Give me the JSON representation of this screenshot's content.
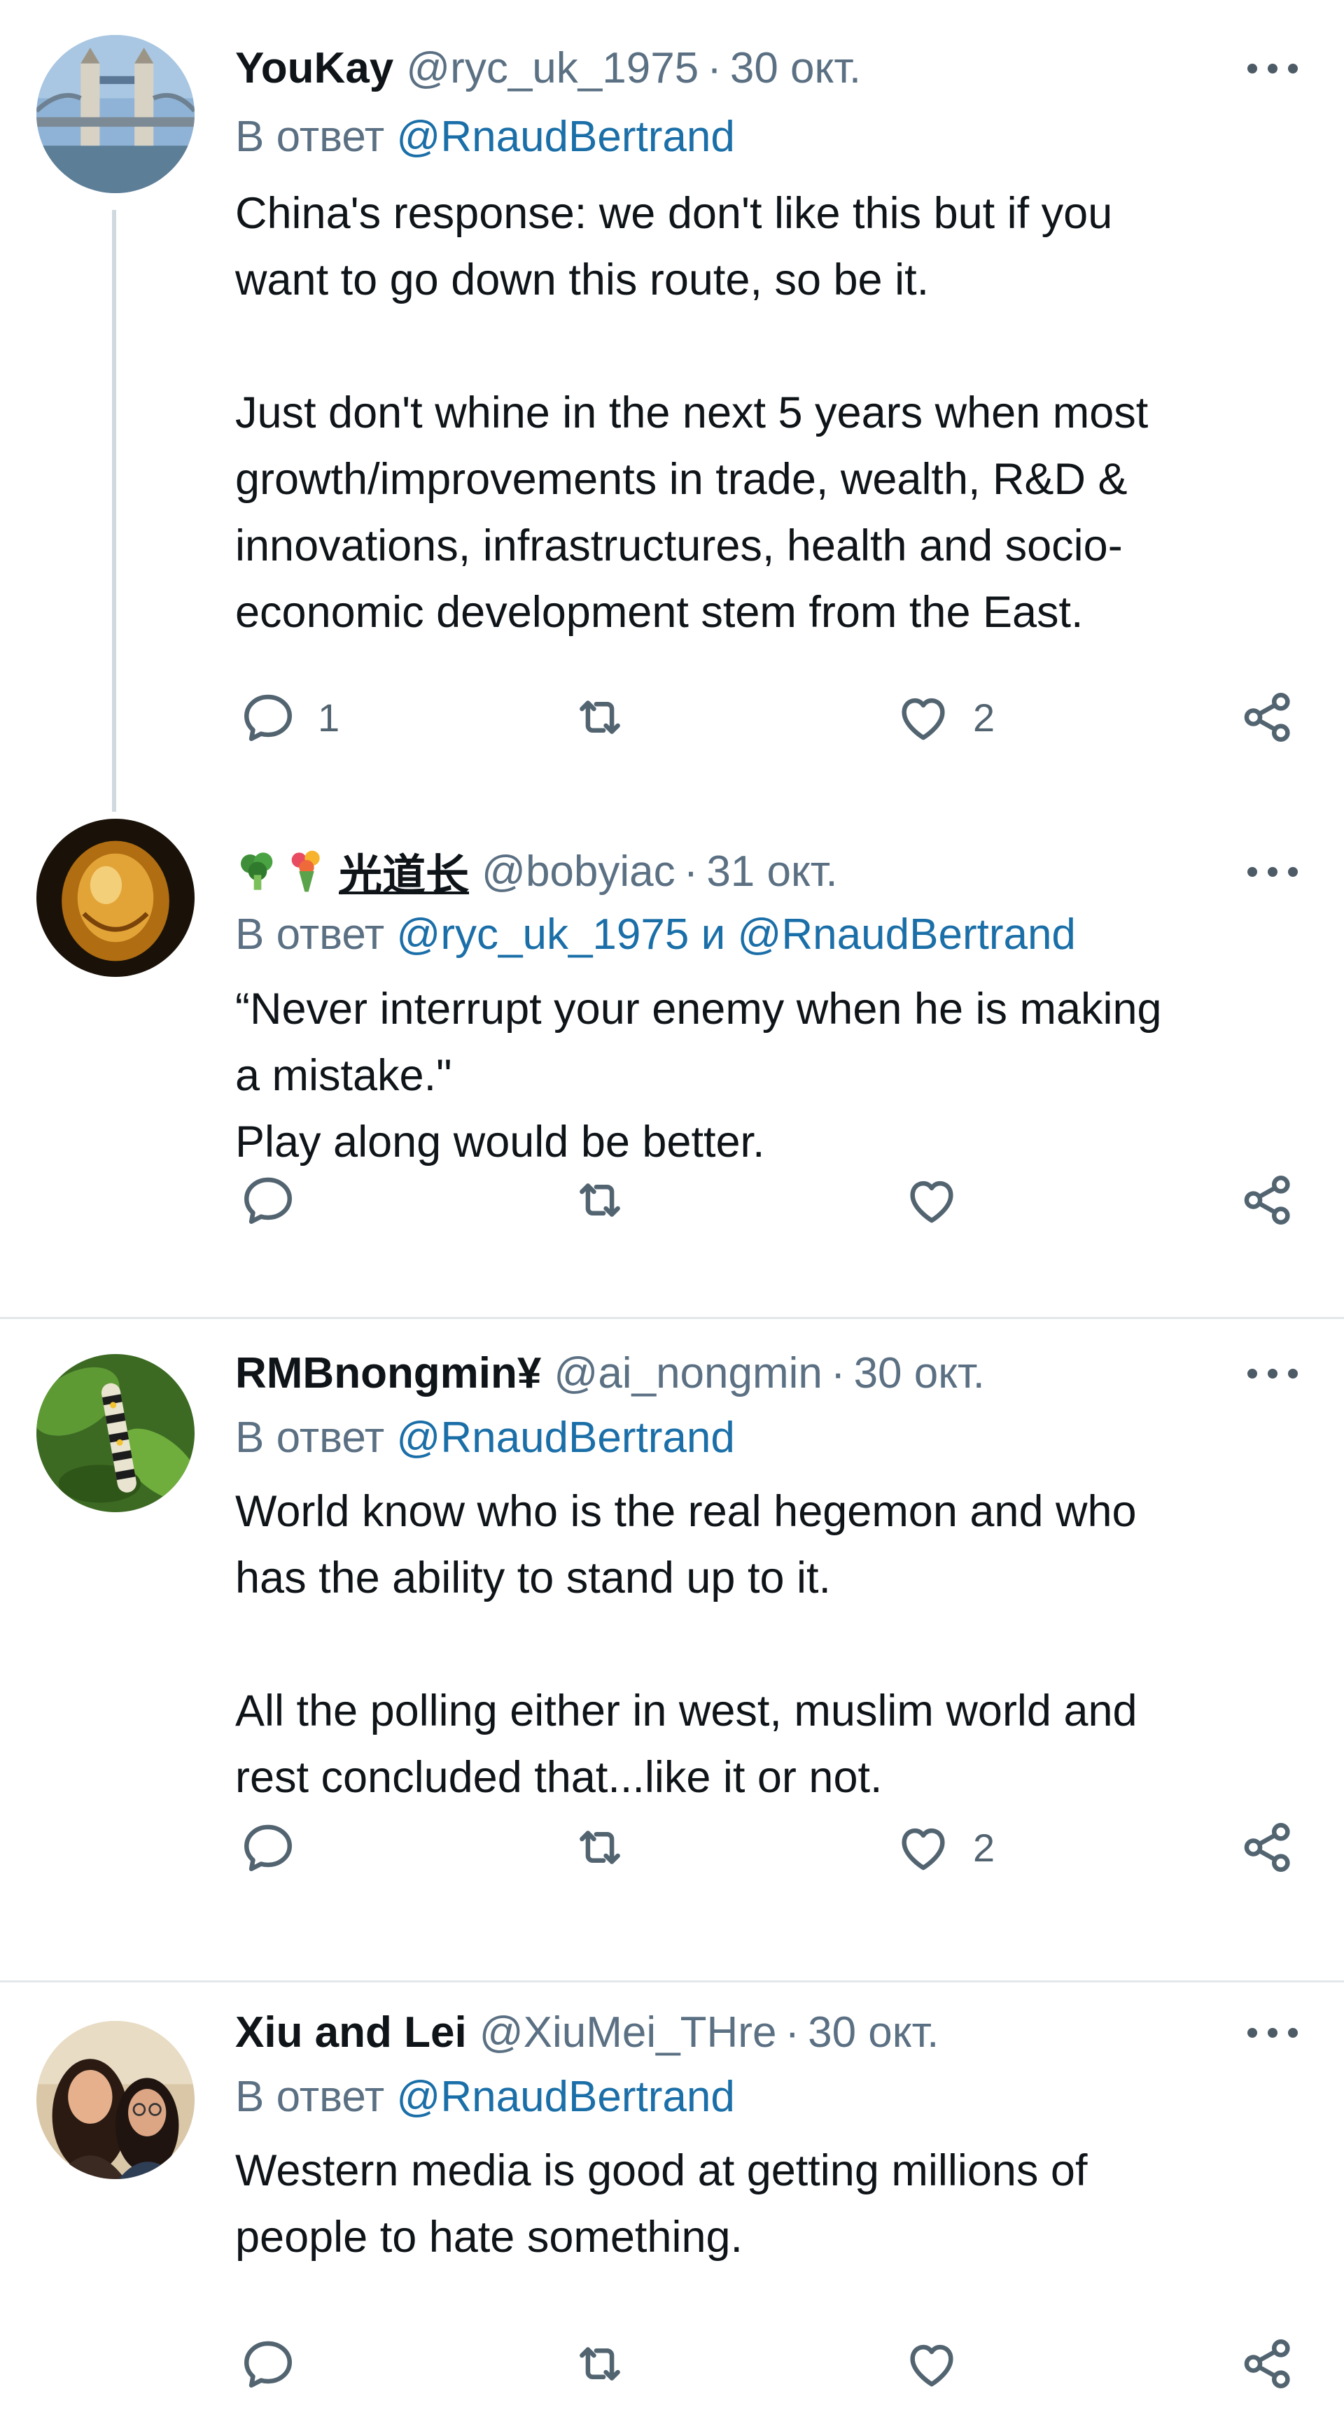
{
  "tweets": [
    {
      "name": "YouKay",
      "name_emojis": [],
      "handle": "@ryc_uk_1975",
      "separator": "·",
      "date": "30 окт.",
      "reply_prefix": "В ответ",
      "reply_mentions": [
        "@RnaudBertrand"
      ],
      "reply_joiner": "",
      "lines": [
        "China's response: we don't like this but if you",
        "want to go down this route, so be it.",
        "",
        "Just don't whine in the next 5 years when most",
        "growth/improvements in trade, wealth, R&D &",
        "innovations, infrastructures, health and socio-",
        "economic development stem from the East."
      ],
      "replies": "1",
      "retweets": "",
      "likes": "2",
      "avatar_icon": "tower-bridge-avatar"
    },
    {
      "name": "光道长",
      "name_emojis": [
        "broccoli-icon",
        "bouquet-icon"
      ],
      "handle": "@bobyiac",
      "separator": "·",
      "date": "31 окт.",
      "reply_prefix": "В ответ",
      "reply_mentions": [
        "@ryc_uk_1975",
        "@RnaudBertrand"
      ],
      "reply_joiner": "и",
      "lines": [
        "“Never interrupt your enemy when he is making",
        "a mistake.\"",
        "Play along would be better."
      ],
      "replies": "",
      "retweets": "",
      "likes": "",
      "avatar_icon": "amber-shell-avatar"
    },
    {
      "name": "RMBnongmin¥",
      "name_emojis": [],
      "handle": "@ai_nongmin",
      "separator": "·",
      "date": "30 окт.",
      "reply_prefix": "В ответ",
      "reply_mentions": [
        "@RnaudBertrand"
      ],
      "reply_joiner": "",
      "lines": [
        "World know who is the real hegemon and who",
        "has the ability to stand up to it.",
        "",
        "All the polling either in west, muslim world and",
        "rest concluded that...like it or not."
      ],
      "replies": "",
      "retweets": "",
      "likes": "2",
      "avatar_icon": "caterpillar-avatar"
    },
    {
      "name": "Xiu and Lei",
      "name_emojis": [],
      "handle": "@XiuMei_THre",
      "separator": "·",
      "date": "30 окт.",
      "reply_prefix": "В ответ",
      "reply_mentions": [
        "@RnaudBertrand"
      ],
      "reply_joiner": "",
      "lines": [
        "Western media is good at getting millions of",
        "people to hate something."
      ],
      "replies": "",
      "retweets": "",
      "likes": "",
      "avatar_icon": "two-women-avatar"
    }
  ],
  "icons": {
    "reply": "reply-icon",
    "retweet": "retweet-icon",
    "like": "heart-icon",
    "share": "share-icon",
    "more": "more-icon"
  },
  "colors": {
    "text": "#0f1419",
    "muted": "#5b7083",
    "mention": "#1b6fa8",
    "divider": "#e3e7ea",
    "thread_line": "#cfd9de",
    "icon": "#536471"
  }
}
